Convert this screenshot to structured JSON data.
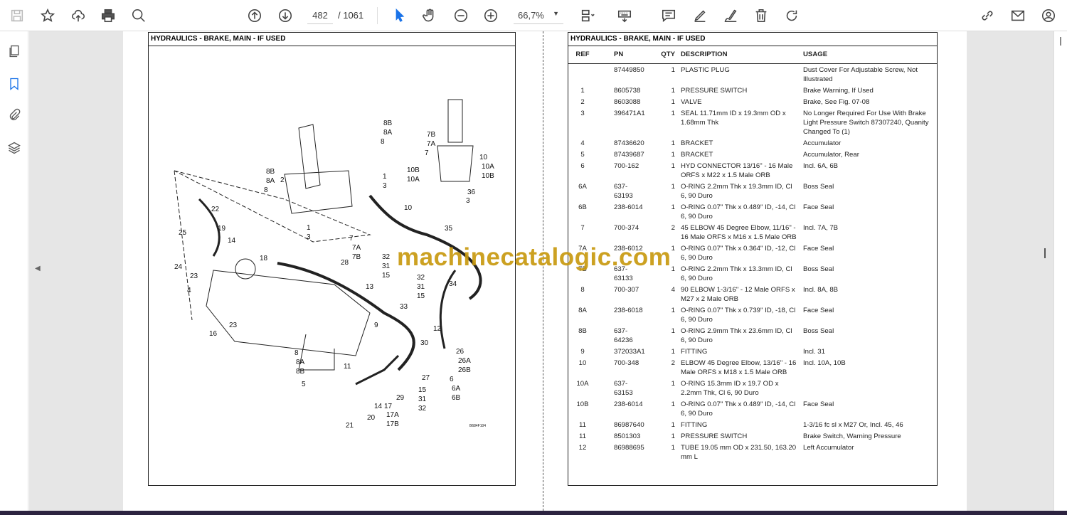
{
  "toolbar": {
    "current_page": "482",
    "total_pages": "/ 1061",
    "zoom": "66,7%",
    "icons": [
      "save-icon",
      "bookmark-star-icon",
      "upload-cloud-icon",
      "print-icon",
      "search-icon",
      "page-up-icon",
      "page-down-icon",
      "select-cursor-icon",
      "hand-icon",
      "zoom-out-icon",
      "zoom-in-icon",
      "fit-page-icon",
      "keyboard-icon",
      "comment-icon",
      "highlight-pen-icon",
      "sign-icon",
      "delete-icon",
      "redo-icon",
      "share-link-icon",
      "mail-icon",
      "account-icon"
    ]
  },
  "sidebar": {
    "icons": [
      "pages-icon",
      "bookmarks-icon",
      "attachments-icon",
      "layers-icon"
    ]
  },
  "left_page": {
    "title": "HYDRAULICS - BRAKE, MAIN - IF USED",
    "callouts": [
      "8B",
      "8A",
      "8",
      "7B",
      "7A",
      "7",
      "10",
      "10A",
      "10B",
      "1",
      "3",
      "8B",
      "8A",
      "8",
      "2",
      "10B",
      "10A",
      "10",
      "36",
      "3",
      "22",
      "19",
      "25",
      "14",
      "18",
      "1",
      "3",
      "7",
      "7A",
      "7B",
      "35",
      "28",
      "32",
      "31",
      "15",
      "24",
      "23",
      "32",
      "31",
      "15",
      "34",
      "4",
      "13",
      "33",
      "9",
      "12",
      "23",
      "16",
      "30",
      "26",
      "26A",
      "26B",
      "8",
      "8A",
      "8B",
      "11",
      "27",
      "6",
      "6A",
      "6B",
      "5",
      "15",
      "31",
      "32",
      "29",
      "14",
      "17",
      "17A",
      "17B",
      "20",
      "21"
    ],
    "figure_id": "B684F104"
  },
  "right_page": {
    "title": "HYDRAULICS - BRAKE, MAIN - IF USED",
    "headers": [
      "REF",
      "PN",
      "QTY",
      "DESCRIPTION",
      "USAGE"
    ],
    "rows": [
      [
        "",
        "87449850",
        "1",
        "PLASTIC PLUG",
        "Dust Cover For Adjustable Screw, Not Illustrated"
      ],
      [
        "1",
        "8605738",
        "1",
        "PRESSURE SWITCH",
        "Brake Warning, If Used"
      ],
      [
        "2",
        "8603088",
        "1",
        "VALVE",
        "Brake, See Fig. 07-08"
      ],
      [
        "3",
        "396471A1",
        "1",
        "SEAL 11.71mm ID x 19.3mm OD x 1.68mm Thk",
        "No Longer Required For Use With Brake Light Pressure Switch 87307240, Quanity Changed To (1)"
      ],
      [
        "4",
        "87436620",
        "1",
        "BRACKET",
        "Accumulator"
      ],
      [
        "5",
        "87439687",
        "1",
        "BRACKET",
        "Accumulator, Rear"
      ],
      [
        "6",
        "700-162",
        "1",
        "HYD CONNECTOR 13/16\" - 16 Male ORFS x M22 x 1.5 Male ORB",
        "Incl. 6A, 6B"
      ],
      [
        "6A",
        "637-63193",
        "1",
        "O-RING 2.2mm Thk x 19.3mm ID, Cl 6, 90 Duro",
        "Boss Seal"
      ],
      [
        "6B",
        "238-6014",
        "1",
        "O-RING 0.07\" Thk x 0.489\" ID, -14, Cl 6, 90 Duro",
        "Face Seal"
      ],
      [
        "7",
        "700-374",
        "2",
        "45 ELBOW 45 Degree Elbow, 11/16\" - 16 Male ORFS x M16 x 1.5 Male ORB",
        "Incl. 7A, 7B"
      ],
      [
        "7A",
        "238-6012",
        "1",
        "O-RING 0.07\" Thk x 0.364\" ID, -12, Cl 6, 90 Duro",
        "Face Seal"
      ],
      [
        "7B",
        "637-63133",
        "1",
        "O-RING 2.2mm Thk x 13.3mm ID, Cl 6, 90 Duro",
        "Boss Seal"
      ],
      [
        "8",
        "700-307",
        "4",
        "90 ELBOW 1-3/16\" - 12 Male ORFS x M27 x 2 Male ORB",
        "Incl. 8A, 8B"
      ],
      [
        "8A",
        "238-6018",
        "1",
        "O-RING 0.07\" Thk x 0.739\" ID, -18, Cl 6, 90 Duro",
        "Face Seal"
      ],
      [
        "8B",
        "637-64236",
        "1",
        "O-RING 2.9mm Thk x 23.6mm ID, Cl 6, 90 Duro",
        "Boss Seal"
      ],
      [
        "9",
        "372033A1",
        "1",
        "FITTING",
        "Incl. 31"
      ],
      [
        "10",
        "700-348",
        "2",
        "ELBOW 45 Degree Elbow, 13/16\" - 16 Male ORFS x M18 x 1.5 Male ORB",
        "Incl. 10A, 10B"
      ],
      [
        "10A",
        "637-63153",
        "1",
        "O-RING 15.3mm ID x 19.7 OD x 2.2mm Thk, Cl 6, 90 Duro",
        ""
      ],
      [
        "10B",
        "238-6014",
        "1",
        "O-RING 0.07\" Thk x 0.489\" ID, -14, Cl 6, 90 Duro",
        "Face Seal"
      ],
      [
        "11",
        "86987640",
        "1",
        "FITTING",
        "1-3/16 fc sl x M27 Or, Incl. 45, 46"
      ],
      [
        "11",
        "8501303",
        "1",
        "PRESSURE SWITCH",
        "Brake Switch, Warning Pressure"
      ],
      [
        "12",
        "86988695",
        "1",
        "TUBE 19.05 mm OD x 231.50, 163.20 mm L",
        "Left Accumulator"
      ]
    ]
  },
  "watermark": "machinecatalogic.com"
}
